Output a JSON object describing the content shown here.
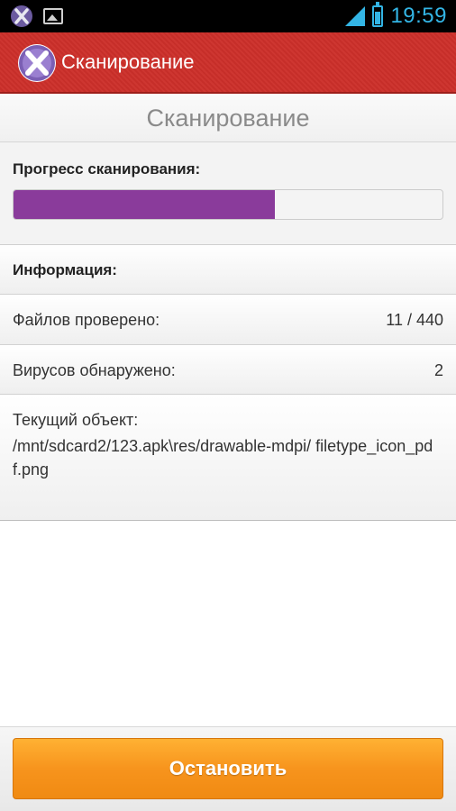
{
  "status_bar": {
    "time": "19:59",
    "icons": [
      "app-notification-icon",
      "image-icon",
      "signal-icon",
      "battery-icon"
    ],
    "accent_color": "#33b5e5"
  },
  "action_bar": {
    "title": "Сканирование",
    "logo_icon": "app-logo-icon",
    "color": "#cc2f2a"
  },
  "screen": {
    "title": "Сканирование"
  },
  "progress": {
    "label": "Прогресс сканирования:",
    "fraction": 0.61,
    "color": "#8a3b9b"
  },
  "info": {
    "header": "Информация:",
    "files_label": "Файлов проверено:",
    "files_value": "11 / 440",
    "viruses_label": "Вирусов обнаружено:",
    "viruses_value": "2",
    "current_label": "Текущий объект:",
    "current_path": "/mnt/sdcard2/123.apk\\res/drawable-mdpi/ filetype_icon_pdf.png"
  },
  "footer": {
    "stop_label": "Остановить",
    "button_color": "#f7941d"
  }
}
